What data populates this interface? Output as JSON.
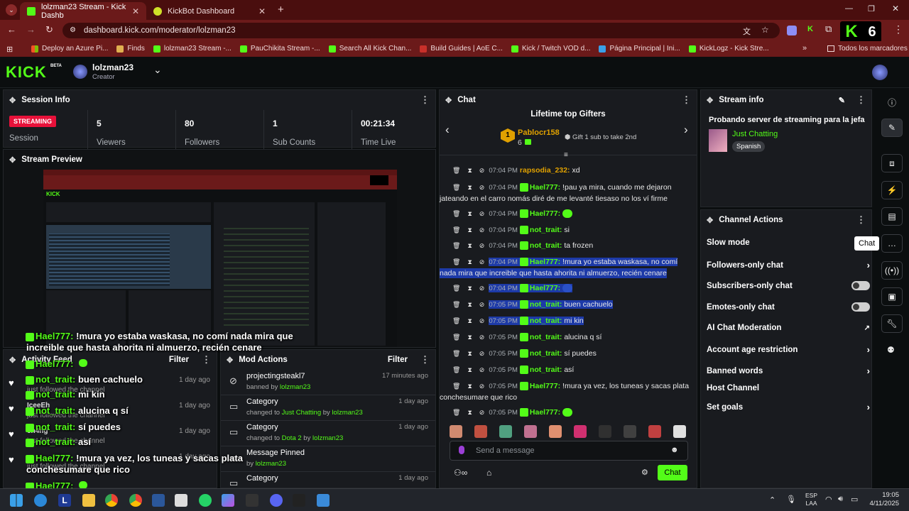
{
  "browser": {
    "tabs": [
      {
        "title": "lolzman23 Stream - Kick Dashb"
      },
      {
        "title": "KickBot Dashboard"
      }
    ],
    "url": "dashboard.kick.com/moderator/lolzman23",
    "bookmarks": [
      "Deploy an Azure Pi...",
      "Finds",
      "lolzman23 Stream -...",
      "PauChikita Stream -...",
      "Search All Kick Chan...",
      "Build Guides | AoE C...",
      "Kick / Twitch VOD d...",
      "Página Principal | Ini...",
      "KickLogz - Kick Stre..."
    ],
    "bookmarks_all": "Todos los marcadores",
    "ext_count": "6"
  },
  "header": {
    "logo": "KICK",
    "beta": "BETA",
    "channel": "lolzman23",
    "role": "Creator"
  },
  "session": {
    "title": "Session Info",
    "status": "STREAMING",
    "status_label": "Session",
    "stats": [
      {
        "value": "5",
        "label": "Viewers"
      },
      {
        "value": "80",
        "label": "Followers"
      },
      {
        "value": "1",
        "label": "Sub Counts"
      },
      {
        "value": "00:21:34",
        "label": "Time Live"
      }
    ]
  },
  "preview": {
    "title": "Stream Preview"
  },
  "activity": {
    "title": "Activity Feed",
    "filter": "Filter",
    "items": [
      {
        "user": "",
        "action": "just followed the channel",
        "time": "1 day ago"
      },
      {
        "user": "IceeEh",
        "action": "just followed the channel",
        "time": "1 day ago"
      },
      {
        "user": "en4ng",
        "action": "just followed the channel",
        "time": "1 day ago"
      },
      {
        "user": "",
        "action": "just followed the channel",
        "time": "1 day ago"
      }
    ]
  },
  "overlay": [
    {
      "user": "Hael777:",
      "text": "!mura yo estaba waskasa, no comí nada mira que"
    },
    {
      "user": "",
      "text": "increible que hasta ahorita ni almuerzo, recién cenare"
    },
    {
      "user": "Hael777:",
      "text": ""
    },
    {
      "user": "not_trait:",
      "text": "buen cachuelo"
    },
    {
      "user": "not_trait:",
      "text": "mi kin"
    },
    {
      "user": "not_trait:",
      "text": "alucina q sí"
    },
    {
      "user": "not_trait:",
      "text": "sí puedes"
    },
    {
      "user": "not_trait:",
      "text": "así"
    },
    {
      "user": "Hael777:",
      "text": "!mura ya vez, los tuneas y sacas plata"
    },
    {
      "user": "",
      "text": "conchesumare que rico"
    },
    {
      "user": "Hael777:",
      "text": ""
    }
  ],
  "modactions": {
    "title": "Mod Actions",
    "filter": "Filter",
    "items": [
      {
        "title": "projectingsteakl7",
        "pre": "banned by",
        "by": "lolzman23",
        "mid": "",
        "target": "",
        "time": "17 minutes ago"
      },
      {
        "title": "Category",
        "pre": "changed to",
        "target": "Just Chatting",
        "mid": "by",
        "by": "lolzman23",
        "time": "1 day ago"
      },
      {
        "title": "Category",
        "pre": "changed to",
        "target": "Dota 2",
        "mid": "by",
        "by": "lolzman23",
        "time": "1 day ago"
      },
      {
        "title": "Message Pinned",
        "pre": "by",
        "by": "lolzman23",
        "mid": "",
        "target": "",
        "time": ""
      },
      {
        "title": "Category",
        "pre": "",
        "by": "",
        "mid": "",
        "target": "",
        "time": "1 day ago"
      }
    ]
  },
  "chat": {
    "title": "Chat",
    "gifters_title": "Lifetime top Gifters",
    "top_gifter": "Pablocr158",
    "gift_count": "6",
    "gift_cta": "Gift 1 sub to take 2nd",
    "messages": [
      {
        "time": "07:04 PM",
        "user": "rapsodia_232:",
        "text": "xd",
        "sel": false
      },
      {
        "time": "07:04 PM",
        "user": "Hael777:",
        "text": "!pau ya mira, cuando me dejaron",
        "cont": "jateando en el carro nomás diré de me levanté tiesaso no los ví firme",
        "sel": false
      },
      {
        "time": "07:04 PM",
        "user": "Hael777:",
        "text": "",
        "sel": false
      },
      {
        "time": "07:04 PM",
        "user": "not_trait:",
        "text": "si",
        "sel": false
      },
      {
        "time": "07:04 PM",
        "user": "not_trait:",
        "text": "ta frozen",
        "sel": false
      },
      {
        "time": "07:04 PM",
        "user": "Hael777:",
        "text": "!mura yo estaba waskasa, no comí",
        "cont": "nada mira que increible que hasta ahorita ni almuerzo, recién cenare",
        "sel": true
      },
      {
        "time": "07:04 PM",
        "user": "Hael777:",
        "text": "",
        "sel": true
      },
      {
        "time": "07:05 PM",
        "user": "not_trait:",
        "text": "buen cachuelo",
        "sel": true
      },
      {
        "time": "07:05 PM",
        "user": "not_trait:",
        "text": "mi kin",
        "sel": true
      },
      {
        "time": "07:05 PM",
        "user": "not_trait:",
        "text": "alucina q sí",
        "sel": false
      },
      {
        "time": "07:05 PM",
        "user": "not_trait:",
        "text": "sí puedes",
        "sel": false
      },
      {
        "time": "07:05 PM",
        "user": "not_trait:",
        "text": "así",
        "sel": false
      },
      {
        "time": "07:05 PM",
        "user": "Hael777:",
        "text": "!mura ya vez, los tuneas y sacas plata",
        "cont": "conchesumare que rico",
        "sel": false
      },
      {
        "time": "07:05 PM",
        "user": "Hael777:",
        "text": "",
        "sel": false
      }
    ],
    "placeholder": "Send a message",
    "send": "Chat"
  },
  "stream_info": {
    "title": "Stream info",
    "stream_title": "Probando server de streaming para la jefa",
    "category": "Just Chatting",
    "language": "Spanish"
  },
  "channel_actions": {
    "title": "Channel Actions",
    "items": [
      {
        "label": "Slow mode",
        "kind": "none"
      },
      {
        "label": "Followers-only chat",
        "kind": "chevron"
      },
      {
        "label": "Subscribers-only chat",
        "kind": "toggle"
      },
      {
        "label": "Emotes-only chat",
        "kind": "toggle"
      },
      {
        "label": "AI Chat Moderation",
        "kind": "external"
      },
      {
        "label": "Account age restriction",
        "kind": "chevron"
      },
      {
        "label": "Banned words",
        "kind": "chevron"
      },
      {
        "label": "Host Channel",
        "kind": "none"
      },
      {
        "label": "Set goals",
        "kind": "chevron"
      }
    ]
  },
  "tooltip": "Chat",
  "taskbar": {
    "lang1": "ESP",
    "lang2": "LAA",
    "time": "19:05",
    "date": "4/11/2025"
  },
  "colors": {
    "accent": "#53fc18",
    "browser": "#6b1a1a",
    "panel": "#191b1f",
    "streaming": "#e8113a",
    "selection": "#1d3aa8"
  }
}
